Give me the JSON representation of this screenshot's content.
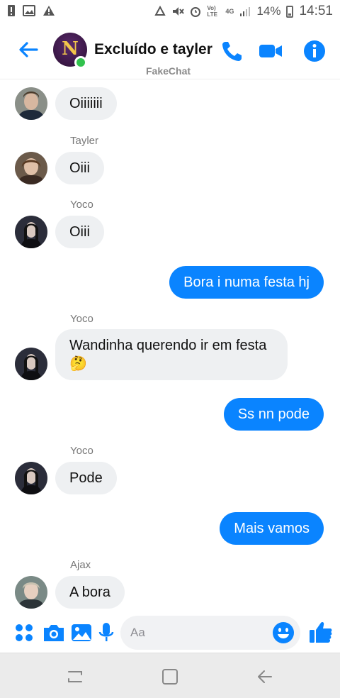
{
  "status_bar": {
    "battery_percent": "14%",
    "time": "14:51",
    "network_4g": "4G",
    "volte": "Vo) LTE"
  },
  "header": {
    "title": "Excluído e tayler",
    "avatar_letter": "N",
    "watermark": "FakeChat",
    "online": true
  },
  "messages": [
    {
      "sender": "",
      "text": "Oiiiiiii",
      "direction": "in",
      "avatar": "avatar-person-1"
    },
    {
      "sender": "Tayler",
      "text": "Oiii",
      "direction": "in",
      "avatar": "avatar-tayler"
    },
    {
      "sender": "Yoco",
      "text": "Oiii",
      "direction": "in",
      "avatar": "avatar-yoco"
    },
    {
      "sender": "",
      "text": "Bora i numa festa hj",
      "direction": "out"
    },
    {
      "sender": "Yoco",
      "text": "Wandinha querendo ir em festa🤔",
      "direction": "in",
      "avatar": "avatar-yoco"
    },
    {
      "sender": "",
      "text": "Ss nn pode",
      "direction": "out"
    },
    {
      "sender": "Yoco",
      "text": "Pode",
      "direction": "in",
      "avatar": "avatar-yoco"
    },
    {
      "sender": "",
      "text": "Mais vamos",
      "direction": "out"
    },
    {
      "sender": "Ajax",
      "text": "A bora",
      "direction": "in",
      "avatar": "avatar-ajax"
    }
  ],
  "composer": {
    "placeholder": "Aa"
  },
  "colors": {
    "accent": "#0a84ff",
    "incoming_bubble": "#eef0f2",
    "online": "#31c24d"
  }
}
